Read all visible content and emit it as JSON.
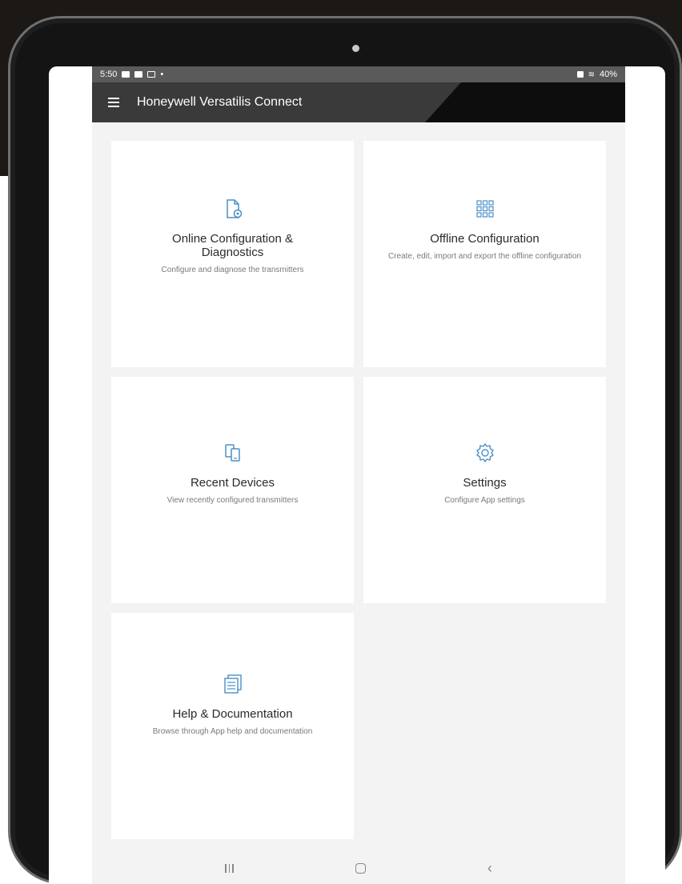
{
  "status_bar": {
    "time": "5:50",
    "battery": "40%"
  },
  "app_bar": {
    "title": "Honeywell Versatilis Connect"
  },
  "cards": [
    {
      "title": "Online Configuration & Diagnostics",
      "description": "Configure and diagnose the transmitters",
      "icon": "document-settings-icon"
    },
    {
      "title": "Offline Configuration",
      "description": "Create, edit, import and export the offline configuration",
      "icon": "grid-icon"
    },
    {
      "title": "Recent Devices",
      "description": "View recently configured transmitters",
      "icon": "devices-icon"
    },
    {
      "title": "Settings",
      "description": "Configure App settings",
      "icon": "gear-icon"
    },
    {
      "title": "Help & Documentation",
      "description": "Browse through App help and documentation",
      "icon": "document-list-icon"
    }
  ],
  "colors": {
    "accent": "#4a90c8",
    "app_bar": "#3a3a3a",
    "background": "#f3f3f3"
  }
}
